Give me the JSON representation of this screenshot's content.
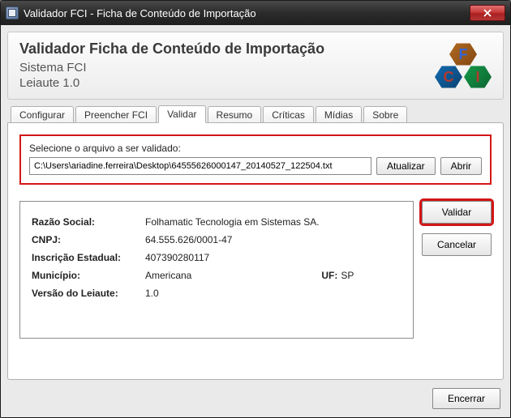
{
  "window": {
    "title": "Validador FCI - Ficha de Conteúdo de Importação"
  },
  "header": {
    "title": "Validador Ficha de Conteúdo de Importação",
    "subtitle1": "Sistema FCI",
    "subtitle2": "Leiaute 1.0",
    "logo_letters": {
      "f": "F",
      "c": "C",
      "i": "I"
    }
  },
  "tabs": [
    {
      "id": "configurar",
      "label": "Configurar",
      "active": false
    },
    {
      "id": "preencher",
      "label": "Preencher FCI",
      "active": false
    },
    {
      "id": "validar",
      "label": "Validar",
      "active": true
    },
    {
      "id": "resumo",
      "label": "Resumo",
      "active": false
    },
    {
      "id": "criticas",
      "label": "Críticas",
      "active": false
    },
    {
      "id": "midias",
      "label": "Mídias",
      "active": false
    },
    {
      "id": "sobre",
      "label": "Sobre",
      "active": false
    }
  ],
  "file_section": {
    "label": "Selecione o arquivo a ser validado:",
    "path": "C:\\Users\\ariadine.ferreira\\Desktop\\64555626000147_20140527_122504.txt",
    "btn_refresh": "Atualizar",
    "btn_open": "Abrir"
  },
  "details": {
    "razao_social_label": "Razão Social:",
    "razao_social_value": "Folhamatic Tecnologia em Sistemas SA.",
    "cnpj_label": "CNPJ:",
    "cnpj_value": "64.555.626/0001-47",
    "ie_label": "Inscrição Estadual:",
    "ie_value": "407390280117",
    "municipio_label": "Município:",
    "municipio_value": "Americana",
    "uf_label": "UF:",
    "uf_value": "SP",
    "versao_label": "Versão do Leiaute:",
    "versao_value": "1.0"
  },
  "actions": {
    "validar": "Validar",
    "cancelar": "Cancelar",
    "encerrar": "Encerrar"
  }
}
